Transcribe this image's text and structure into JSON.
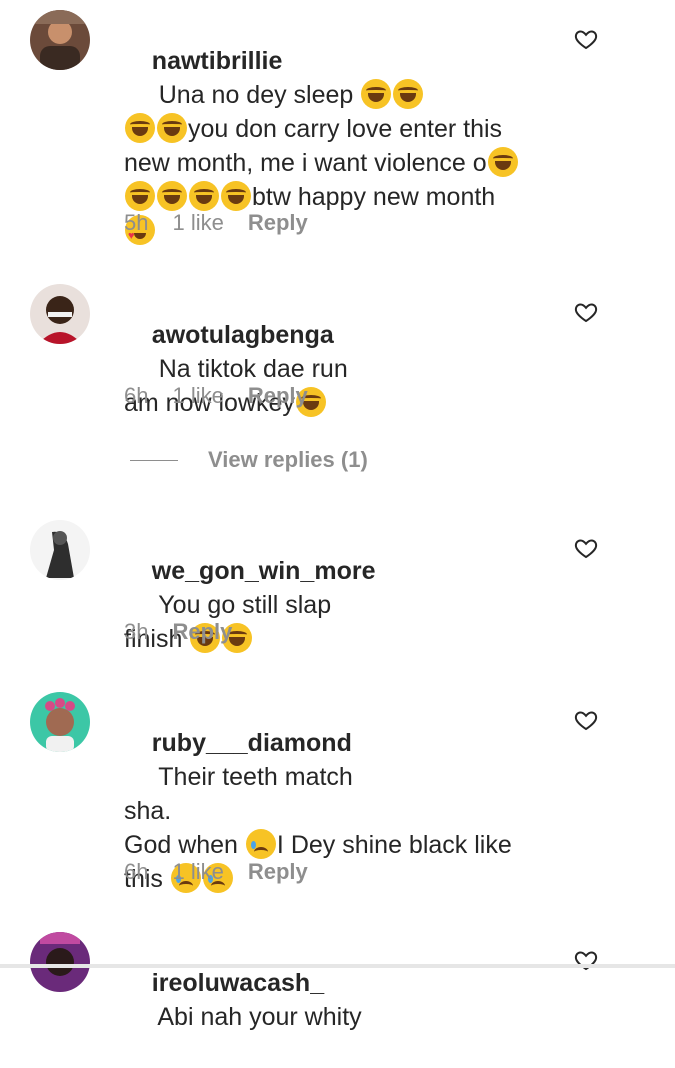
{
  "comments": [
    {
      "username": "nawtibrillie",
      "text": "Una no dey sleep 😂😂😂😂you don carry love enter this new month, me i want violence o😂😂😂😂😂btw happy new month 😍",
      "time": "5h",
      "likes": "1 like",
      "reply": "Reply"
    },
    {
      "username": "awotulagbenga",
      "text": "Na tiktok dae run am now lowkey😂",
      "time": "6h",
      "likes": "1 like",
      "reply": "Reply"
    },
    {
      "username": "we_gon_win_more",
      "text": "You go still slap finish 😂😂",
      "time": "3h",
      "likes": "",
      "reply": "Reply"
    },
    {
      "username": "ruby___diamond",
      "text": "Their teeth match sha.\nGod when 😢I Dey shine black like this 😢😢",
      "time": "6h",
      "likes": "1 like",
      "reply": "Reply"
    },
    {
      "username": "ireoluwacash_",
      "text": "Abi nah your whity",
      "time": "",
      "likes": "",
      "reply": ""
    }
  ],
  "view_replies": "View replies (1)",
  "colors": {
    "text": "#262626",
    "meta": "#8e8e8e",
    "background": "#ffffff"
  }
}
